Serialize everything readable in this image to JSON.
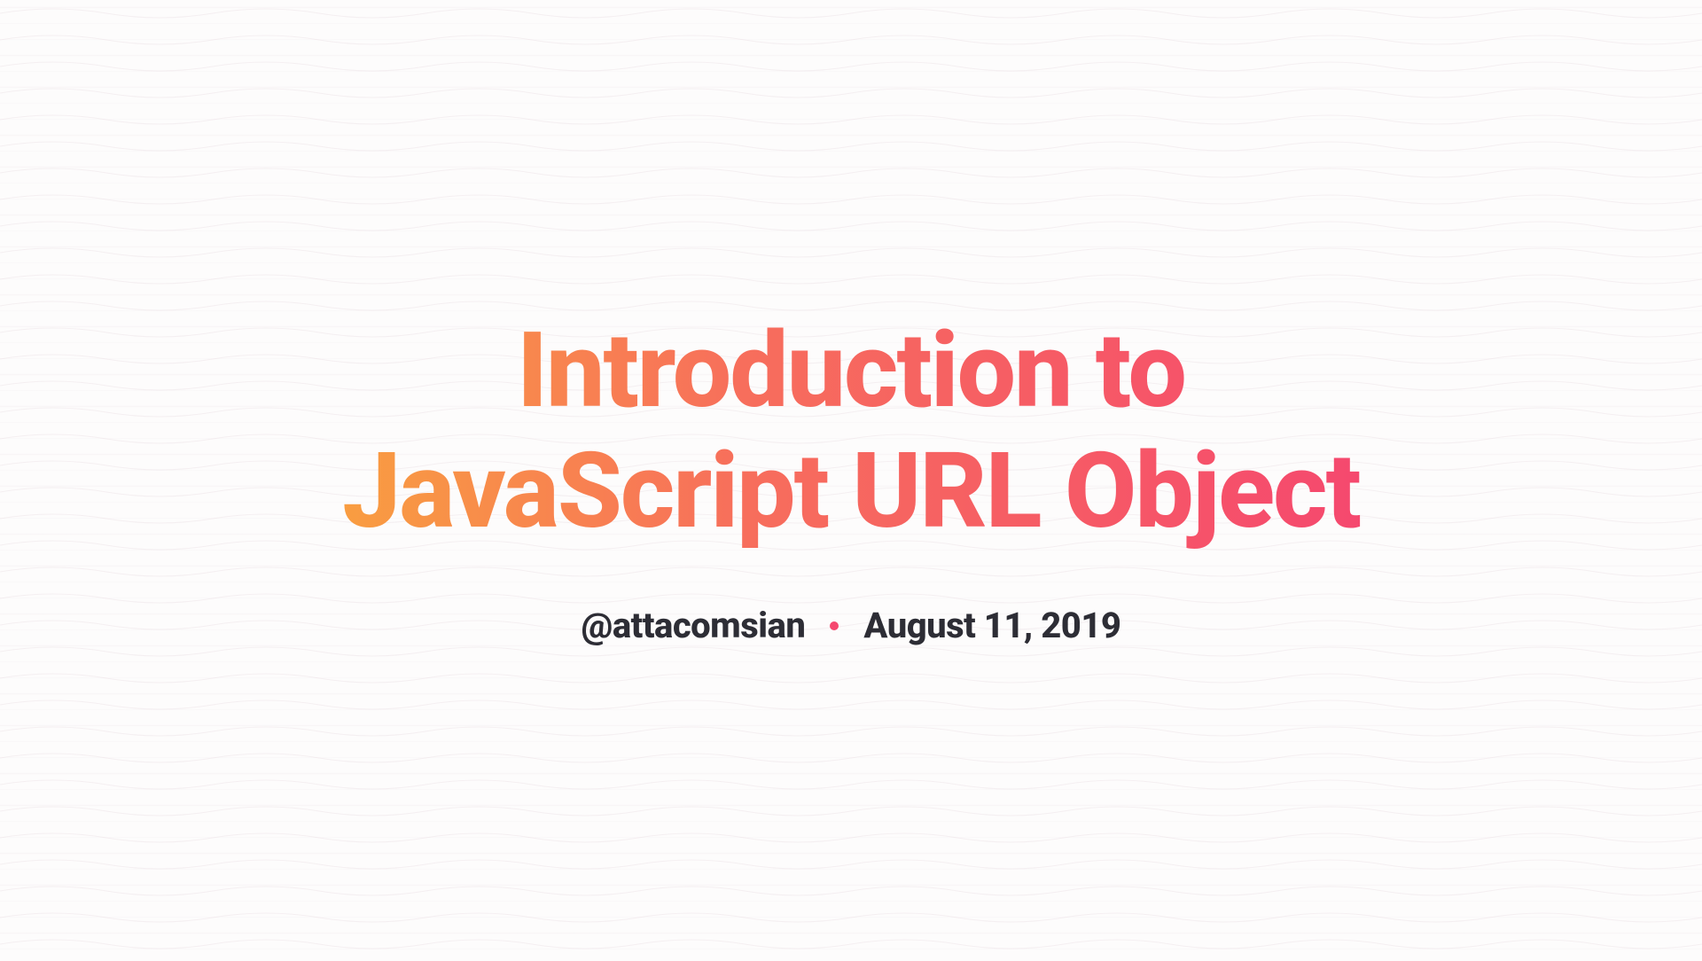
{
  "title": "Introduction to JavaScript URL Object",
  "meta": {
    "author": "@attacomsian",
    "date": "August 11, 2019"
  }
}
